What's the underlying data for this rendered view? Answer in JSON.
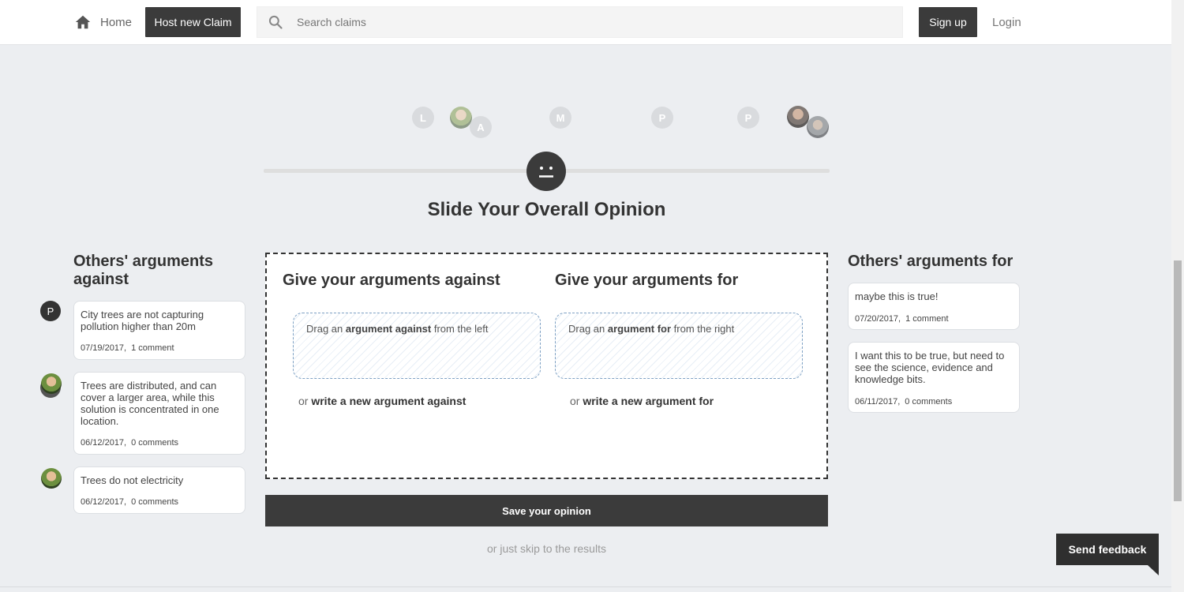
{
  "nav": {
    "home_label": "Home",
    "host_label": "Host new Claim",
    "search_placeholder": "Search claims",
    "signup_label": "Sign up",
    "login_label": "Login"
  },
  "avatars": [
    "L",
    "A",
    "M",
    "P",
    "P"
  ],
  "slider": {
    "title": "Slide Your Overall Opinion",
    "position": 0.5
  },
  "against": {
    "title": "Others' arguments against",
    "cards": [
      {
        "text": "City trees are not capturing pollution higher than 20m",
        "date": "07/19/2017,",
        "comments": "1 comment",
        "author": "P"
      },
      {
        "text": "Trees are distributed, and can cover a larger area, while this solution is concentrated in one location.",
        "date": "06/12/2017,",
        "comments": "0 comments"
      },
      {
        "text": "Trees do not electricity",
        "date": "06/12/2017,",
        "comments": "0 comments"
      }
    ]
  },
  "for": {
    "title": "Others' arguments for",
    "cards": [
      {
        "text": "maybe this is true!",
        "date": "07/20/2017,",
        "comments": "1 comment"
      },
      {
        "text": "I want this to be true, but need to see the science, evidence and knowledge bits.",
        "date": "06/11/2017,",
        "comments": "0 comments"
      }
    ]
  },
  "center": {
    "against_title": "Give your arguments against",
    "for_title": "Give your arguments for",
    "drop_against": {
      "pre": "Drag an ",
      "bold": "argument against",
      "post": " from the left"
    },
    "drop_for": {
      "pre": "Drag an ",
      "bold": "argument for",
      "post": " from the right"
    },
    "write_against": {
      "pre": "or ",
      "bold": "write a new argument against"
    },
    "write_for": {
      "pre": "or ",
      "bold": "write a new argument for"
    }
  },
  "save_label": "Save your opinion",
  "skip_label": "or just skip to the results",
  "feedback_label": "Send feedback"
}
